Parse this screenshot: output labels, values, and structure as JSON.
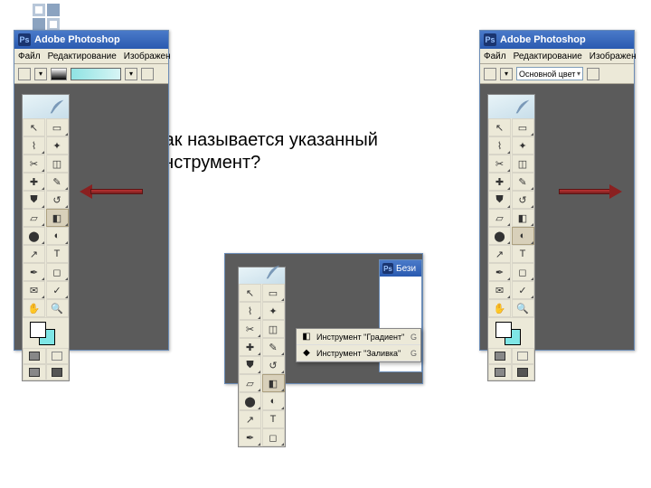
{
  "decor_bullets": true,
  "question": "Как называется указанный\nинструмент?",
  "app_title": "Adobe Photoshop",
  "menu": {
    "file": "Файл",
    "edit": "Редактирование",
    "image": "Изображен"
  },
  "right_optbar": {
    "label": "Основной цвет"
  },
  "doc_title": "Бези",
  "flyout": {
    "items": [
      {
        "label": "Инструмент \"Градиент\"",
        "shortcut": "G"
      },
      {
        "label": "Инструмент \"Заливка\"",
        "shortcut": "G"
      }
    ]
  },
  "tools": [
    {
      "name": "move",
      "glyph": "↖"
    },
    {
      "name": "marquee",
      "glyph": "▭"
    },
    {
      "name": "lasso",
      "glyph": "⌇"
    },
    {
      "name": "wand",
      "glyph": "✦"
    },
    {
      "name": "crop",
      "glyph": "✂"
    },
    {
      "name": "slice",
      "glyph": "◫"
    },
    {
      "name": "patch",
      "glyph": "✚"
    },
    {
      "name": "brush",
      "glyph": "✎"
    },
    {
      "name": "stamp",
      "glyph": "⛊"
    },
    {
      "name": "history-brush",
      "glyph": "↺"
    },
    {
      "name": "eraser",
      "glyph": "▱"
    },
    {
      "name": "gradient",
      "glyph": "◧"
    },
    {
      "name": "blur",
      "glyph": "⬤"
    },
    {
      "name": "dodge",
      "glyph": "◐"
    },
    {
      "name": "path",
      "glyph": "↗"
    },
    {
      "name": "type",
      "glyph": "T"
    },
    {
      "name": "pen",
      "glyph": "✒"
    },
    {
      "name": "shape",
      "glyph": "◻"
    },
    {
      "name": "notes",
      "glyph": "✉"
    },
    {
      "name": "eyedropper",
      "glyph": "✓"
    },
    {
      "name": "hand",
      "glyph": "✋"
    },
    {
      "name": "zoom",
      "glyph": "🔍"
    }
  ]
}
